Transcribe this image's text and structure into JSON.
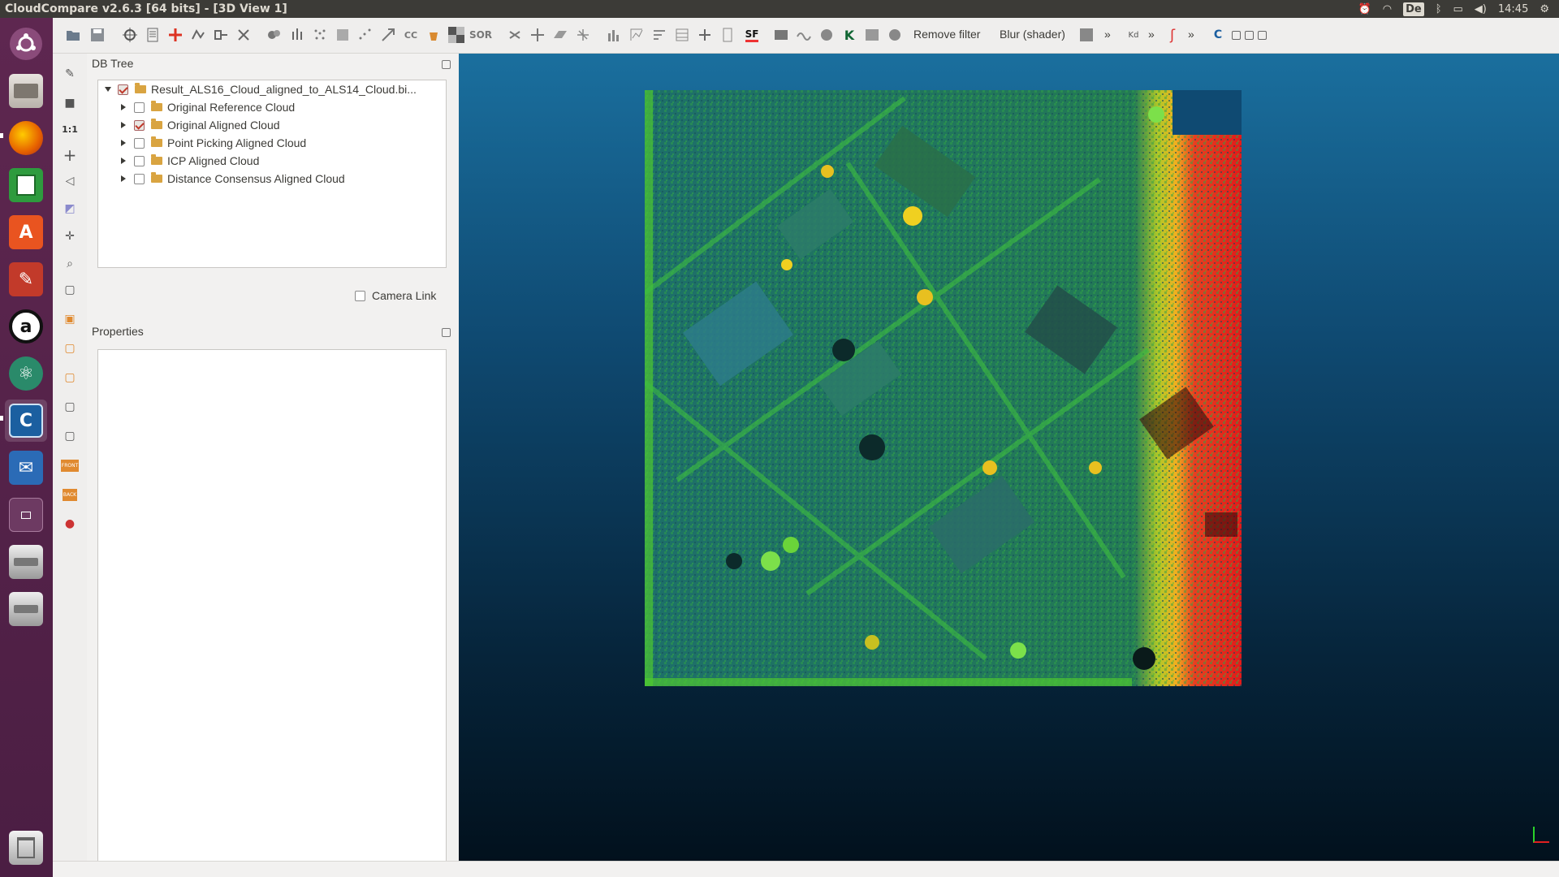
{
  "window": {
    "title": "CloudCompare v2.6.3 [64 bits] - [3D View 1]"
  },
  "system_tray": {
    "keyboard_layout": "De",
    "time": "14:45"
  },
  "launcher": {
    "apps": [
      "ubuntu-dash",
      "files",
      "firefox",
      "libreoffice-calc",
      "ubuntu-software",
      "system-settings",
      "amazon",
      "atom",
      "cloudcompare",
      "thunderbird",
      "workspace-switcher",
      "drive",
      "drive",
      "trash"
    ]
  },
  "toolbar": {
    "remove_filter": "Remove filter",
    "blur_shader": "Blur (shader)",
    "sor_label": "SOR",
    "sf_label": "SF",
    "more": "»"
  },
  "vertical_toolbar": {
    "one_to_one": "1:1",
    "front": "FRONT",
    "back": "BACK"
  },
  "db_tree": {
    "title": "DB Tree",
    "root": {
      "label": "Result_ALS16_Cloud_aligned_to_ALS14_Cloud.bi...",
      "checked": true,
      "expanded": true
    },
    "children": [
      {
        "label": "Original Reference Cloud",
        "checked": false
      },
      {
        "label": "Original Aligned Cloud",
        "checked": true
      },
      {
        "label": "Point Picking Aligned Cloud",
        "checked": false
      },
      {
        "label": "ICP Aligned Cloud",
        "checked": false
      },
      {
        "label": "Distance Consensus Aligned Cloud",
        "checked": false
      }
    ]
  },
  "camera_link": {
    "label": "Camera Link",
    "checked": false
  },
  "properties": {
    "title": "Properties"
  },
  "view3d": {
    "background_top": "#1a6f9e",
    "background_bottom": "#02111d",
    "cloud_colors": [
      "#1f6f6a",
      "#2a8f3a",
      "#6ddc2a",
      "#f0d020",
      "#f07020",
      "#e82020"
    ]
  }
}
